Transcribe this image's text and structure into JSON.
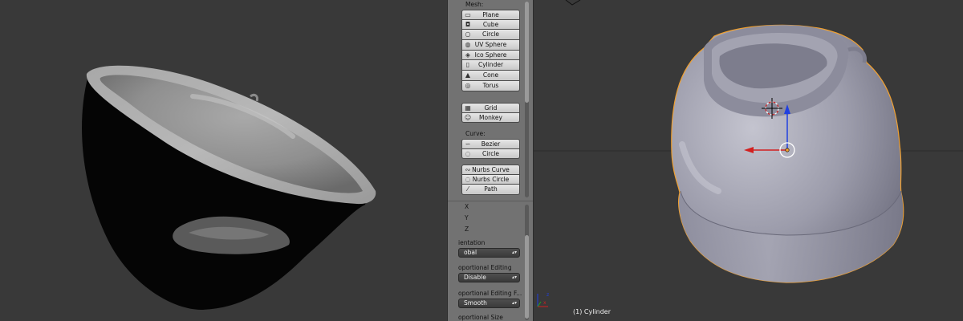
{
  "toolshelf": {
    "mesh_label": "Mesh:",
    "mesh_buttons": [
      {
        "label": "Plane",
        "icon": "plane-icon",
        "glyph": "▭"
      },
      {
        "label": "Cube",
        "icon": "cube-icon",
        "glyph": "◘"
      },
      {
        "label": "Circle",
        "icon": "circle-icon",
        "glyph": "○"
      },
      {
        "label": "UV Sphere",
        "icon": "uv-sphere-icon",
        "glyph": "◍"
      },
      {
        "label": "Ico Sphere",
        "icon": "ico-sphere-icon",
        "glyph": "◈"
      },
      {
        "label": "Cylinder",
        "icon": "cylinder-icon",
        "glyph": "▯"
      },
      {
        "label": "Cone",
        "icon": "cone-icon",
        "glyph": "▲"
      },
      {
        "label": "Torus",
        "icon": "torus-icon",
        "glyph": "◎"
      }
    ],
    "mesh_buttons2": [
      {
        "label": "Grid",
        "icon": "grid-icon",
        "glyph": "▦"
      },
      {
        "label": "Monkey",
        "icon": "monkey-icon",
        "glyph": "☺"
      }
    ],
    "curve_label": "Curve:",
    "curve_buttons": [
      {
        "label": "Bezier",
        "icon": "bezier-icon",
        "glyph": "∽"
      },
      {
        "label": "Circle",
        "icon": "bezier-circle-icon",
        "glyph": "◌"
      }
    ],
    "curve_buttons2": [
      {
        "label": "Nurbs Curve",
        "icon": "nurbs-curve-icon",
        "glyph": "∾"
      },
      {
        "label": "Nurbs Circle",
        "icon": "nurbs-circle-icon",
        "glyph": "◌"
      },
      {
        "label": "Path",
        "icon": "path-icon",
        "glyph": "⁄"
      }
    ],
    "axes": [
      "X",
      "Y",
      "Z"
    ],
    "orientation_label": "ientation",
    "orientation_value": "obal",
    "prop_editing_label": "oportional Editing",
    "prop_editing_value": "Disable",
    "prop_falloff_label": "oportional Editing F...",
    "prop_falloff_value": "Smooth",
    "prop_size_label": "oportional Size"
  },
  "viewport_right": {
    "object_label": "(1) Cylinder"
  },
  "colors": {
    "background": "#393939",
    "selection_outline": "#f0a030",
    "x_axis": "#d22020",
    "z_axis": "#2040e0"
  }
}
